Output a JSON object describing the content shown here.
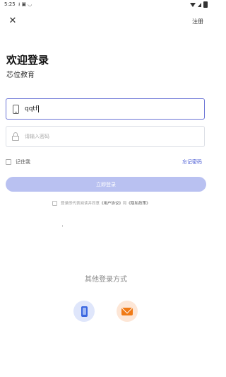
{
  "status_bar": {
    "time": "5:25",
    "left_icons": [
      "download-icon",
      "notification-icon",
      "cast-icon"
    ],
    "right_icons": [
      "wifi-icon",
      "signal-icon",
      "battery-icon"
    ]
  },
  "header": {
    "close_icon": "close-icon",
    "register_label": "注册"
  },
  "titles": {
    "welcome": "欢迎登录",
    "subtitle": "芯位教育"
  },
  "form": {
    "phone_value": "qqtf",
    "password_placeholder": "请输入密码",
    "remember_label": "记住我",
    "forgot_label": "忘记密码",
    "login_label": "立即登录"
  },
  "agreement": {
    "prefix": "登录即代表阅读并同意",
    "user_agreement": "《用户协议》",
    "and": "和",
    "privacy_policy": "《隐私政策》"
  },
  "other_login": {
    "title": "其他登录方式",
    "methods": [
      "phone-login-icon",
      "email-login-icon"
    ]
  },
  "colors": {
    "accent": "#4a5bd4",
    "login_button_bg": "#b9c1f1",
    "phone_method_bg": "#dfe6fb",
    "mail_method_bg": "#fde6d6",
    "mail_icon": "#f07a16",
    "phone_icon": "#3a66e0"
  }
}
